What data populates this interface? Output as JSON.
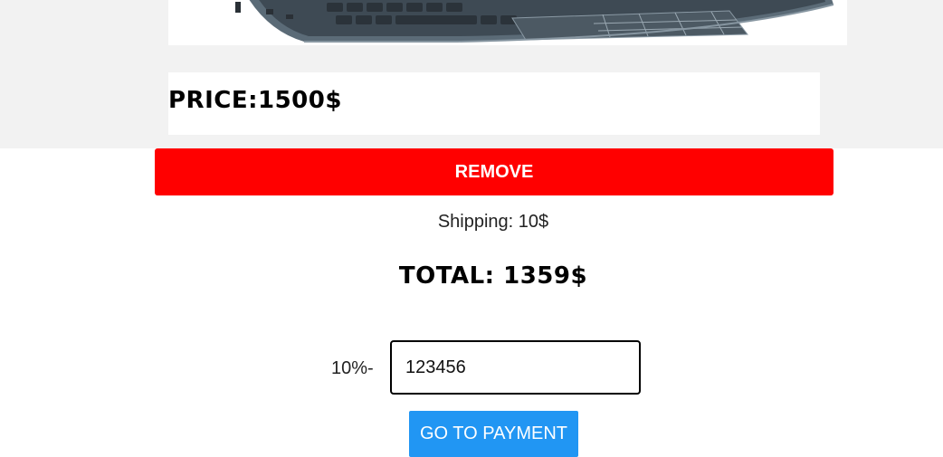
{
  "product": {
    "image_icon": "laptop-icon",
    "price_text": "PRICE:1500$"
  },
  "cart": {
    "remove_label": "REMOVE",
    "shipping_text": "Shipping: 10$",
    "total_text": "TOTAL: 1359$"
  },
  "coupon": {
    "discount_label": "10%-",
    "value": "123456"
  },
  "checkout": {
    "pay_label": "GO TO PAYMENT"
  },
  "colors": {
    "remove_bg": "#ff0000",
    "pay_bg": "#2196f3",
    "band_bg": "#f2f2f2"
  }
}
